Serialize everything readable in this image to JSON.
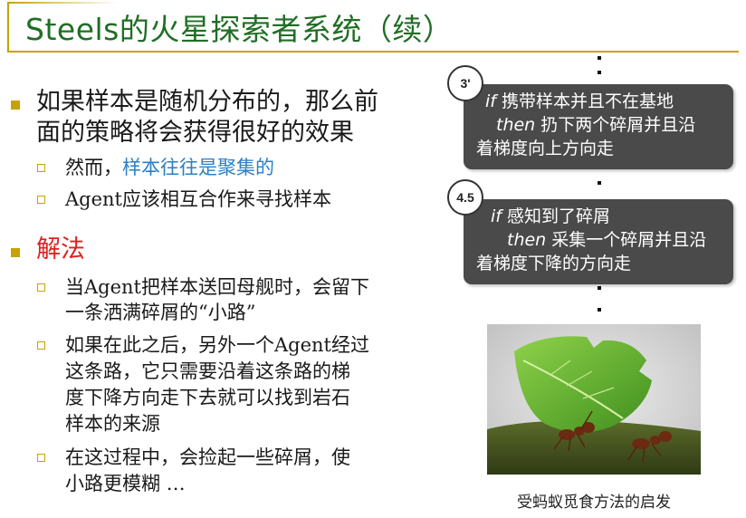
{
  "title": "Steels的火星探索者系统（续）",
  "colors": {
    "accent": "#c8a200",
    "title": "#1f6e24",
    "highlight_blue": "#2a7fc4",
    "highlight_red": "#e02020",
    "rule_box": "#4a4a4a"
  },
  "bullets": {
    "b1": {
      "line1": "如果样本是随机分布的，那么前",
      "line2": "面的策略将会获得很好的效果",
      "sub1_prefix": "然而，",
      "sub1_highlight": "样本往往是聚集的",
      "sub2": "Agent应该相互合作来寻找样本"
    },
    "b2": {
      "label": "解法",
      "sub1_line1": "当Agent把样本送回母舰时，会留下",
      "sub1_line2": "一条洒满碎屑的“小路”",
      "sub2_line1": "如果在此之后，另外一个Agent经过",
      "sub2_line2": "这条路，它只需要沿着这条路的梯",
      "sub2_line3": "度下降方向走下去就可以找到岩石",
      "sub2_line4": "样本的来源",
      "sub3_line1": "在这过程中，会捡起一些碎屑，使",
      "sub3_line2": "小路更模糊 …"
    }
  },
  "rules": [
    {
      "badge": "3'",
      "if_kw": "if",
      "cond": " 携带样本并且不在基地",
      "then_kw": "then",
      "action1": " 扔下两个碎屑并且沿",
      "action2": "着梯度向上方向走"
    },
    {
      "badge": "4.5",
      "if_kw": "if",
      "cond": " 感知到了碎屑",
      "then_kw": "then",
      "action1": " 采集一个碎屑并且沿",
      "action2": "着梯度下降的方向走"
    }
  ],
  "figure": {
    "caption": "受蚂蚁觅食方法的启发"
  }
}
